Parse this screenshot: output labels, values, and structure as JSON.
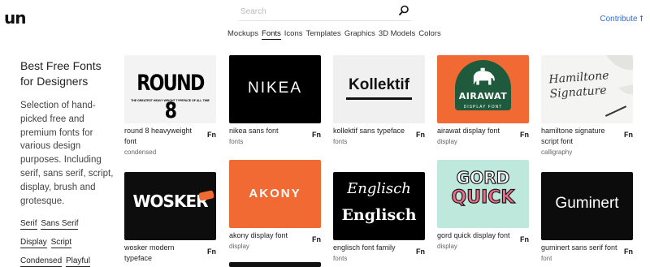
{
  "header": {
    "logo": "un",
    "search_placeholder": "Search",
    "contribute": "Contribute ⭡"
  },
  "categories": [
    "Mockups",
    "Fonts",
    "Icons",
    "Templates",
    "Graphics",
    "3D Models",
    "Colors"
  ],
  "active_category": "Fonts",
  "sidebar": {
    "title": "Best Free Fonts for Designers",
    "description": "Selection of hand-picked free and premium fonts for various design purposes. Including serif, sans serif, script, display, brush and grotesque.",
    "tags": [
      "Serif",
      "Sans Serif",
      "Display",
      "Script",
      "Condensed",
      "Playful"
    ]
  },
  "cards": [
    {
      "title": "round 8 heavyweight font",
      "category": "condensed",
      "badge": "Fn",
      "art": "ROUND 8",
      "art_sub": "THE GREATEST HEAVY WEIGHT TYPEFACE OF ALL TIME"
    },
    {
      "title": "nikea sans font",
      "category": "fonts",
      "badge": "Fn",
      "art": "NIKEA"
    },
    {
      "title": "kollektif sans typeface",
      "category": "fonts",
      "badge": "Fn",
      "art": "Kollektif"
    },
    {
      "title": "airawat display font",
      "category": "display",
      "badge": "Fn",
      "art": "AIRAWAT",
      "art_sub": "DISPLAY FONT"
    },
    {
      "title": "hamiltone signature script font",
      "category": "calligraphy",
      "badge": "Fn",
      "art": "Hamiltone Signature"
    },
    {
      "title": "wosker modern typeface",
      "category": "",
      "badge": "Fn",
      "art": "WOSKER"
    },
    {
      "title": "akony display font",
      "category": "display",
      "badge": "Fn",
      "art": "AKONY"
    },
    {
      "title": "englisch font family",
      "category": "fonts",
      "badge": "Fn",
      "art": "Englisch",
      "art_sub": "Englisch"
    },
    {
      "title": "gord quick display font",
      "category": "display",
      "badge": "Fn",
      "art": "GORD",
      "art_sub": "QUICK"
    },
    {
      "title": "guminert sans serif font",
      "category": "font",
      "badge": "Fn",
      "art": "Guminert"
    }
  ],
  "colors": {
    "accent": "#2b6fd6",
    "nikea_bg": "#000000",
    "airawat_bg": "#f26a33",
    "akony_bg": "#f26a33",
    "gord_bg": "#bfe8dd",
    "guminert_bg": "#0c0c0c"
  }
}
